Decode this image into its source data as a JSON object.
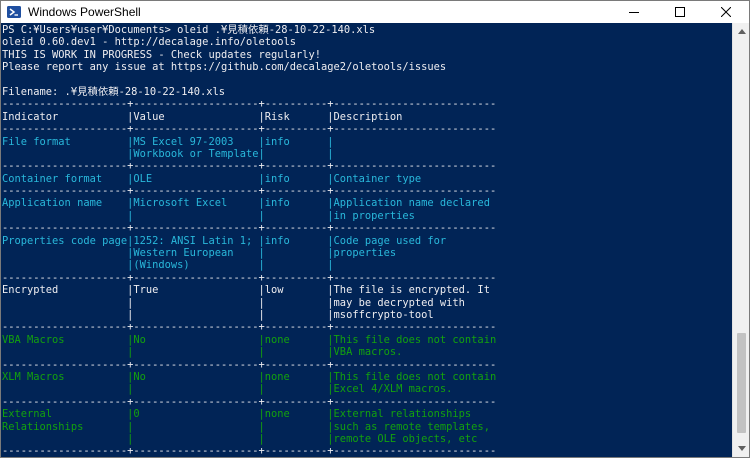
{
  "window": {
    "title": "Windows PowerShell",
    "colors": {
      "console_bg": "#012456",
      "text": "#eeedf0",
      "cyan": "#29b8db",
      "green": "#13a10e",
      "titlebar_bg": "#ffffff"
    },
    "icons": {
      "app": "powershell-icon",
      "minimize": "minimize-icon",
      "maximize": "maximize-icon",
      "close": "close-icon"
    }
  },
  "console": {
    "lines": [
      {
        "text": "PS C:¥Users¥user¥Documents> oleid .¥見積依頼-28-10-22-140.xls",
        "color": "text"
      },
      {
        "text": "oleid 0.60.dev1 - http://decalage.info/oletools",
        "color": "text"
      },
      {
        "text": "THIS IS WORK IN PROGRESS - Check updates regularly!",
        "color": "text"
      },
      {
        "text": "Please report any issue at https://github.com/decalage2/oletools/issues",
        "color": "text"
      },
      {
        "text": "",
        "color": "text"
      },
      {
        "text": "Filename: .¥見積依頼-28-10-22-140.xls",
        "color": "text"
      },
      {
        "text": "--------------------+--------------------+----------+--------------------------",
        "color": "text"
      },
      {
        "text": "Indicator           |Value               |Risk      |Description",
        "color": "text"
      },
      {
        "text": "--------------------+--------------------+----------+--------------------------",
        "color": "text"
      },
      {
        "text": "File format         |MS Excel 97-2003    |info      |",
        "color": "cyan"
      },
      {
        "text": "                    |Workbook or Template|          |",
        "color": "cyan"
      },
      {
        "text": "--------------------+--------------------+----------+--------------------------",
        "color": "text"
      },
      {
        "text": "Container format    |OLE                 |info      |Container type",
        "color": "cyan"
      },
      {
        "text": "--------------------+--------------------+----------+--------------------------",
        "color": "text"
      },
      {
        "text": "Application name    |Microsoft Excel     |info      |Application name declared",
        "color": "cyan"
      },
      {
        "text": "                    |                    |          |in properties",
        "color": "cyan"
      },
      {
        "text": "--------------------+--------------------+----------+--------------------------",
        "color": "text"
      },
      {
        "text": "Properties code page|1252: ANSI Latin 1; |info      |Code page used for",
        "color": "cyan"
      },
      {
        "text": "                    |Western European    |          |properties",
        "color": "cyan"
      },
      {
        "text": "                    |(Windows)           |          |",
        "color": "cyan"
      },
      {
        "text": "--------------------+--------------------+----------+--------------------------",
        "color": "text"
      },
      {
        "text": "Encrypted           |True                |low       |The file is encrypted. It",
        "color": "text"
      },
      {
        "text": "                    |                    |          |may be decrypted with",
        "color": "text"
      },
      {
        "text": "                    |                    |          |msoffcrypto-tool",
        "color": "text"
      },
      {
        "text": "--------------------+--------------------+----------+--------------------------",
        "color": "text"
      },
      {
        "text": "VBA Macros          |No                  |none      |This file does not contain",
        "color": "green"
      },
      {
        "text": "                    |                    |          |VBA macros.",
        "color": "green"
      },
      {
        "text": "--------------------+--------------------+----------+--------------------------",
        "color": "text"
      },
      {
        "text": "XLM Macros          |No                  |none      |This file does not contain",
        "color": "green"
      },
      {
        "text": "                    |                    |          |Excel 4/XLM macros.",
        "color": "green"
      },
      {
        "text": "--------------------+--------------------+----------+--------------------------",
        "color": "text"
      },
      {
        "text": "External            |0                   |none      |External relationships",
        "color": "green"
      },
      {
        "text": "Relationships       |                    |          |such as remote templates,",
        "color": "green"
      },
      {
        "text": "                    |                    |          |remote OLE objects, etc",
        "color": "green"
      },
      {
        "text": "--------------------+--------------------+----------+--------------------------",
        "color": "text"
      }
    ]
  }
}
